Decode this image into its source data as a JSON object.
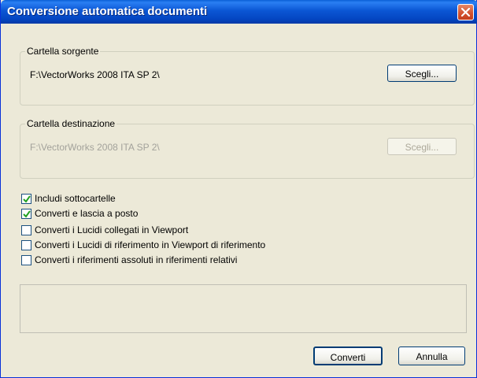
{
  "window": {
    "title": "Conversione automatica documenti"
  },
  "source": {
    "label": "Cartella sorgente",
    "path": "F:\\VectorWorks 2008 ITA SP 2\\",
    "button": "Scegli..."
  },
  "destination": {
    "label": "Cartella destinazione",
    "path": "F:\\VectorWorks 2008 ITA SP 2\\",
    "button": "Scegli..."
  },
  "options": [
    {
      "label": "Includi sottocartelle",
      "checked": true
    },
    {
      "label": "Converti e lascia a posto",
      "checked": true
    },
    {
      "label": "Converti i Lucidi collegati in Viewport",
      "checked": false
    },
    {
      "label": "Converti i Lucidi di riferimento in Viewport di riferimento",
      "checked": false
    },
    {
      "label": "Converti i riferimenti assoluti in riferimenti relativi",
      "checked": false
    }
  ],
  "buttons": {
    "convert": "Converti",
    "cancel": "Annulla"
  },
  "colors": {
    "titlebar": "#0b56d4",
    "dialog": "#ece9d8",
    "check": "#21a121"
  }
}
